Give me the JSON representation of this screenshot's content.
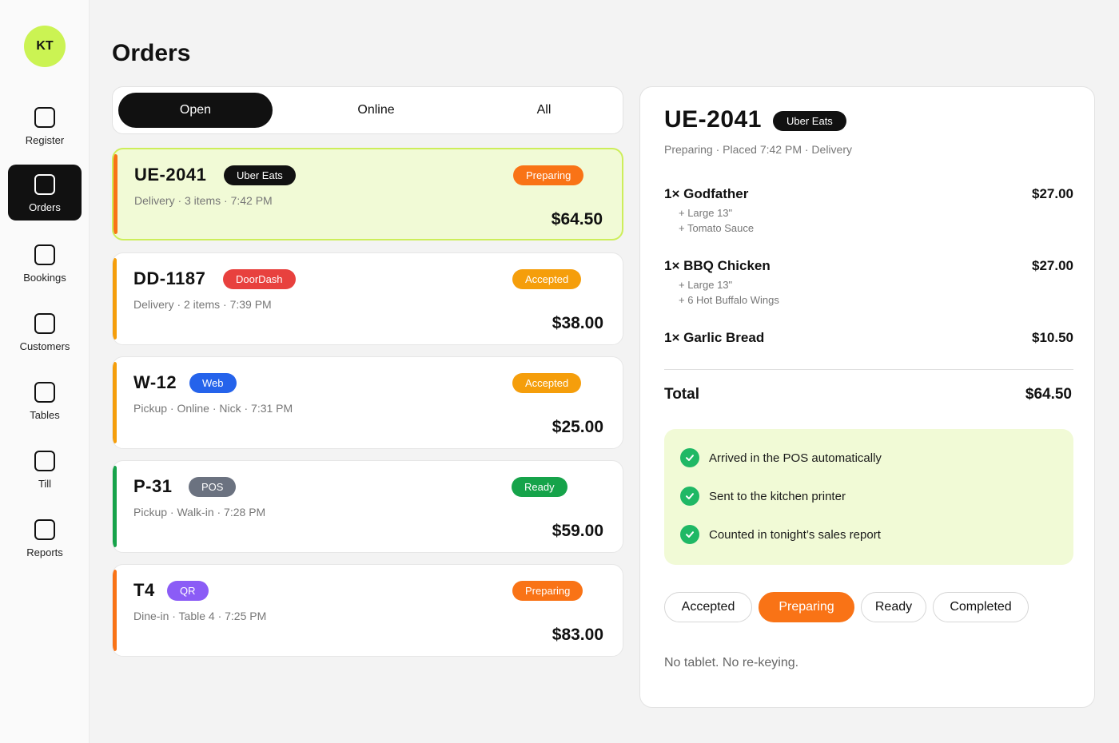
{
  "user": {
    "initials": "KT"
  },
  "sidebar": {
    "items": [
      {
        "label": "Register",
        "active": false
      },
      {
        "label": "Orders",
        "active": true
      },
      {
        "label": "Bookings",
        "active": false
      },
      {
        "label": "Customers",
        "active": false
      },
      {
        "label": "Tables",
        "active": false
      },
      {
        "label": "Till",
        "active": false
      },
      {
        "label": "Reports",
        "active": false
      }
    ]
  },
  "page": {
    "title": "Orders"
  },
  "tabs": [
    {
      "label": "Open",
      "active": true
    },
    {
      "label": "Online",
      "active": false
    },
    {
      "label": "All",
      "active": false
    }
  ],
  "orders": [
    {
      "id": "UE-2041",
      "source": "Uber Eats",
      "source_color": "#111111",
      "status": "Preparing",
      "status_color": "#f97316",
      "accent": "#f97316",
      "meta": "Delivery · 3 items · 7:42 PM",
      "total": "$64.50",
      "selected": true
    },
    {
      "id": "DD-1187",
      "source": "DoorDash",
      "source_color": "#e8413e",
      "status": "Accepted",
      "status_color": "#f59e0b",
      "accent": "#f59e0b",
      "meta": "Delivery · 2 items · 7:39 PM",
      "total": "$38.00",
      "selected": false
    },
    {
      "id": "W-12",
      "source": "Web",
      "source_color": "#2563eb",
      "status": "Accepted",
      "status_color": "#f59e0b",
      "accent": "#f59e0b",
      "meta": "Pickup · Online · Nick · 7:31 PM",
      "total": "$25.00",
      "selected": false
    },
    {
      "id": "P-31",
      "source": "POS",
      "source_color": "#6b7280",
      "status": "Ready",
      "status_color": "#16a34a",
      "accent": "#16a34a",
      "meta": "Pickup · Walk-in · 7:28 PM",
      "total": "$59.00",
      "selected": false
    },
    {
      "id": "T4",
      "source": "QR",
      "source_color": "#8b5cf6",
      "status": "Preparing",
      "status_color": "#f97316",
      "accent": "#f97316",
      "meta": "Dine-in · Table 4 · 7:25 PM",
      "total": "$83.00",
      "selected": false
    }
  ],
  "detail": {
    "id": "UE-2041",
    "source": "Uber Eats",
    "meta": "Preparing · Placed 7:42 PM · Delivery",
    "items": [
      {
        "name": "1× Godfather",
        "price": "$27.00",
        "modifiers": [
          "+ Large 13\"",
          "+ Tomato Sauce"
        ]
      },
      {
        "name": "1× BBQ Chicken",
        "price": "$27.00",
        "modifiers": [
          "+ Large 13\"",
          "+ 6 Hot Buffalo Wings"
        ]
      },
      {
        "name": "1× Garlic Bread",
        "price": "$10.50",
        "modifiers": []
      }
    ],
    "total_label": "Total",
    "total": "$64.50",
    "checks": [
      "Arrived in the POS automatically",
      "Sent to the kitchen printer",
      "Counted in tonight’s sales report"
    ],
    "status_buttons": [
      {
        "label": "Accepted",
        "active": false
      },
      {
        "label": "Preparing",
        "active": true
      },
      {
        "label": "Ready",
        "active": false
      },
      {
        "label": "Completed",
        "active": false
      }
    ],
    "footnote": "No tablet. No re-keying."
  },
  "colors": {
    "accent_lime": "#cbf353",
    "selected_bg": "#f1fad6",
    "check_green": "#1fb865",
    "active_orange": "#f97316"
  }
}
